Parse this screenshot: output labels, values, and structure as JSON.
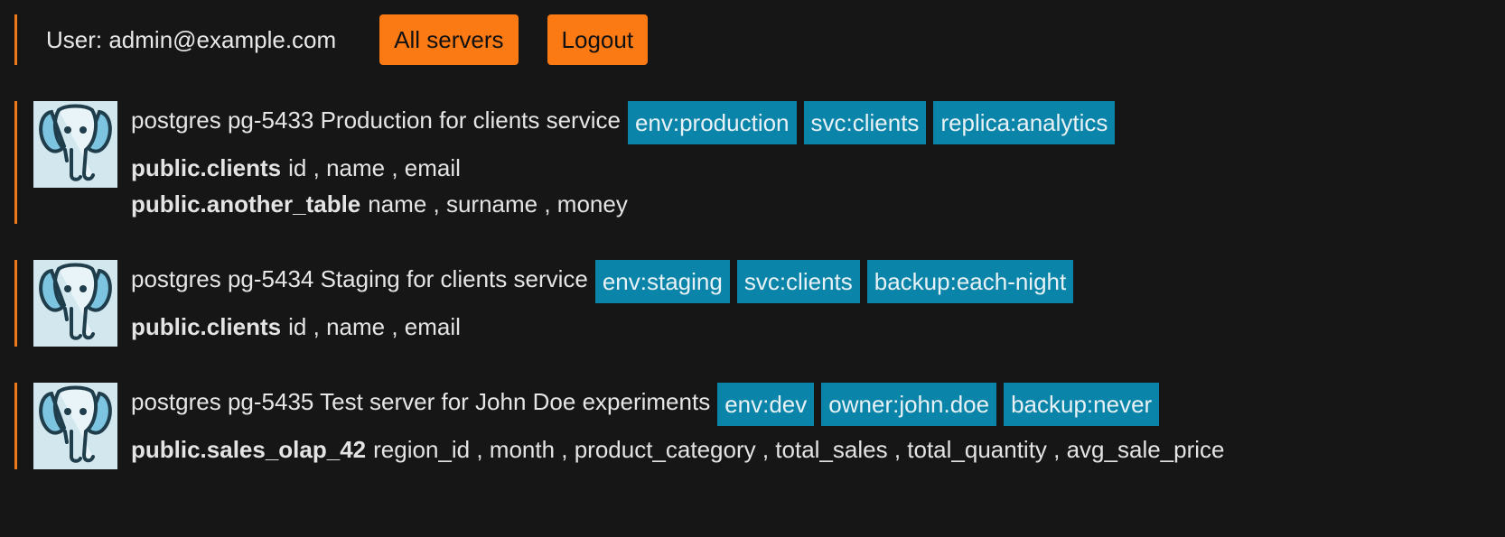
{
  "header": {
    "user_label": "User: admin@example.com",
    "all_servers_label": "All servers",
    "logout_label": "Logout"
  },
  "servers": [
    {
      "title": "postgres pg-5433 Production for clients service",
      "icon": "postgres-elephant-icon",
      "tags": [
        "env:production",
        "svc:clients",
        "replica:analytics"
      ],
      "tables": [
        {
          "name": "public.clients",
          "columns": "id , name , email"
        },
        {
          "name": "public.another_table",
          "columns": "name , surname , money"
        }
      ]
    },
    {
      "title": "postgres pg-5434 Staging for clients service",
      "icon": "postgres-elephant-icon",
      "tags": [
        "env:staging",
        "svc:clients",
        "backup:each-night"
      ],
      "tables": [
        {
          "name": "public.clients",
          "columns": "id , name , email"
        }
      ]
    },
    {
      "title": "postgres pg-5435 Test server for John Doe experiments",
      "icon": "postgres-elephant-icon",
      "tags": [
        "env:dev",
        "owner:john.doe",
        "backup:never"
      ],
      "tables": [
        {
          "name": "public.sales_olap_42",
          "columns": "region_id , month , product_category , total_sales , total_quantity , avg_sale_price"
        }
      ]
    }
  ],
  "colors": {
    "background": "#161617",
    "accent": "#fc7a14",
    "tag": "#0a84a8"
  }
}
